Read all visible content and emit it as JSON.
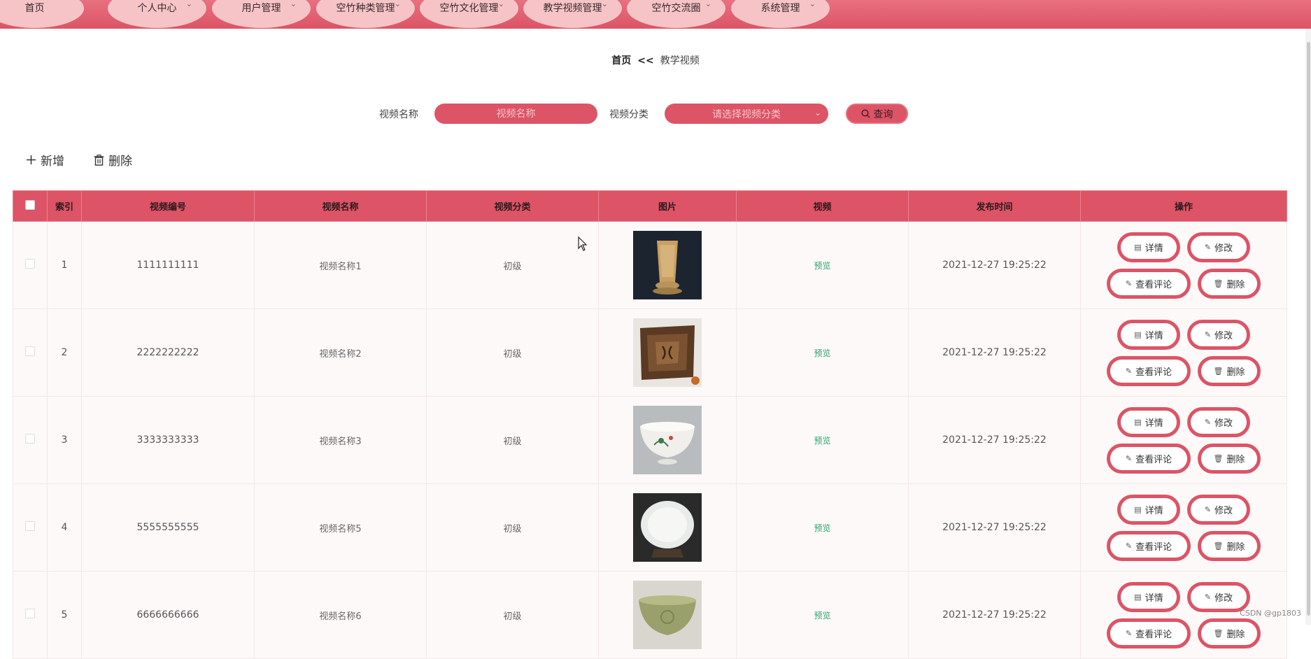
{
  "nav": {
    "items": [
      {
        "label": "首页",
        "has_dropdown": false
      },
      {
        "label": "个人中心",
        "has_dropdown": true
      },
      {
        "label": "用户管理",
        "has_dropdown": true
      },
      {
        "label": "空竹种类管理",
        "has_dropdown": true
      },
      {
        "label": "空竹文化管理",
        "has_dropdown": true
      },
      {
        "label": "教学视频管理",
        "has_dropdown": true
      },
      {
        "label": "空竹交流圈",
        "has_dropdown": true
      },
      {
        "label": "系统管理",
        "has_dropdown": true
      }
    ],
    "chevron_icon": "chevron-down-icon"
  },
  "breadcrumb": {
    "home": "首页",
    "separator": "<<",
    "current": "教学视频"
  },
  "search": {
    "name_label": "视频名称",
    "name_placeholder": "视频名称",
    "category_label": "视频分类",
    "category_placeholder": "请选择视频分类",
    "query_label": "查询",
    "query_icon": "search-icon"
  },
  "toolbar": {
    "add_label": "新增",
    "add_icon": "plus-icon",
    "delete_label": "删除",
    "delete_icon": "trash-icon"
  },
  "table": {
    "headers": {
      "index": "索引",
      "video_no": "视频编号",
      "video_name": "视频名称",
      "video_category": "视频分类",
      "image": "图片",
      "video": "视频",
      "publish_time": "发布时间",
      "actions": "操作"
    },
    "rows": [
      {
        "index": "1",
        "video_no": "1111111111",
        "video_name": "视频名称1",
        "video_category": "初级",
        "video": "预览",
        "publish_time": "2021-12-27 19:25:22",
        "image_icon": "jade-cup-photo"
      },
      {
        "index": "2",
        "video_no": "2222222222",
        "video_name": "视频名称2",
        "video_category": "初级",
        "video": "预览",
        "publish_time": "2021-12-27 19:25:22",
        "image_icon": "carved-tray-photo"
      },
      {
        "index": "3",
        "video_no": "3333333333",
        "video_name": "视频名称3",
        "video_category": "初级",
        "video": "预览",
        "publish_time": "2021-12-27 19:25:22",
        "image_icon": "porcelain-bowl-photo"
      },
      {
        "index": "4",
        "video_no": "5555555555",
        "video_name": "视频名称5",
        "video_category": "初级",
        "video": "预览",
        "publish_time": "2021-12-27 19:25:22",
        "image_icon": "white-dish-photo"
      },
      {
        "index": "5",
        "video_no": "6666666666",
        "video_name": "视频名称6",
        "video_category": "初级",
        "video": "预览",
        "publish_time": "2021-12-27 19:25:22",
        "image_icon": "celadon-bowl-photo"
      }
    ],
    "actions": {
      "detail": "详情",
      "edit": "修改",
      "view_comments": "查看评论",
      "delete": "删除"
    }
  },
  "colors": {
    "accent": "#dc5466",
    "nav_pill": "#f6c4c7",
    "preview_link": "#2aa36b"
  },
  "watermark": "CSDN @gp1803"
}
